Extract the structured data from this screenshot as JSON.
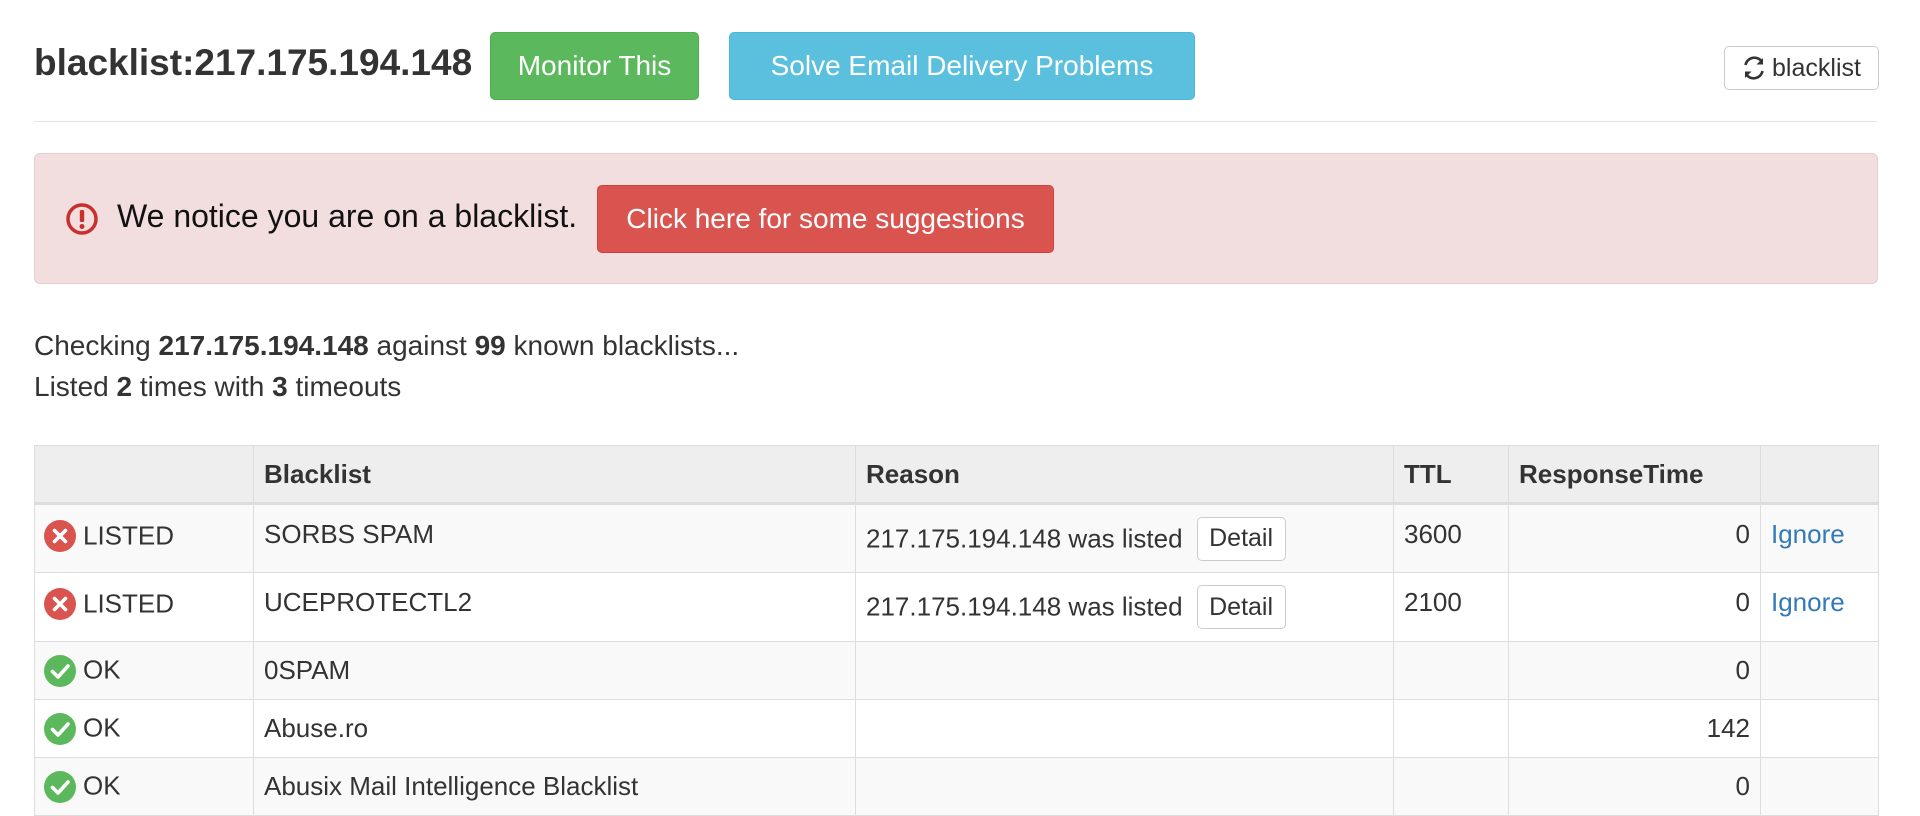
{
  "header": {
    "title": "blacklist:217.175.194.148",
    "monitor_label": "Monitor This",
    "solve_label": "Solve Email Delivery Problems",
    "refresh_label": "blacklist"
  },
  "alert": {
    "message": "We notice you are on a blacklist.",
    "button_label": "Click here for some suggestions"
  },
  "summary": {
    "checking_prefix": "Checking",
    "ip": "217.175.194.148",
    "against_text": "against",
    "count": "99",
    "known_text": "known blacklists...",
    "listed_prefix": "Listed",
    "listed_count": "2",
    "times_text": "times with",
    "timeouts_count": "3",
    "timeouts_text": "timeouts"
  },
  "table": {
    "headers": [
      "",
      "Blacklist",
      "Reason",
      "TTL",
      "ResponseTime",
      ""
    ],
    "rows": [
      {
        "status": "LISTED",
        "blacklist": "SORBS SPAM",
        "reason": "217.175.194.148 was listed",
        "detail": "Detail",
        "ttl": "3600",
        "response": "0",
        "action": "Ignore"
      },
      {
        "status": "LISTED",
        "blacklist": "UCEPROTECTL2",
        "reason": "217.175.194.148 was listed",
        "detail": "Detail",
        "ttl": "2100",
        "response": "0",
        "action": "Ignore"
      },
      {
        "status": "OK",
        "blacklist": "0SPAM",
        "reason": "",
        "ttl": "",
        "response": "0",
        "action": ""
      },
      {
        "status": "OK",
        "blacklist": "Abuse.ro",
        "reason": "",
        "ttl": "",
        "response": "142",
        "action": ""
      },
      {
        "status": "OK",
        "blacklist": "Abusix Mail Intelligence Blacklist",
        "reason": "",
        "ttl": "",
        "response": "0",
        "action": ""
      }
    ]
  },
  "colors": {
    "success": "#5cb85c",
    "info": "#5bc0de",
    "danger": "#d9534f",
    "alert_bg": "#f2dede",
    "link": "#337ab7"
  },
  "icons": {
    "refresh": "refresh-icon",
    "alert": "exclamation-circle-icon",
    "listed": "x-circle-icon",
    "ok": "check-circle-icon"
  }
}
